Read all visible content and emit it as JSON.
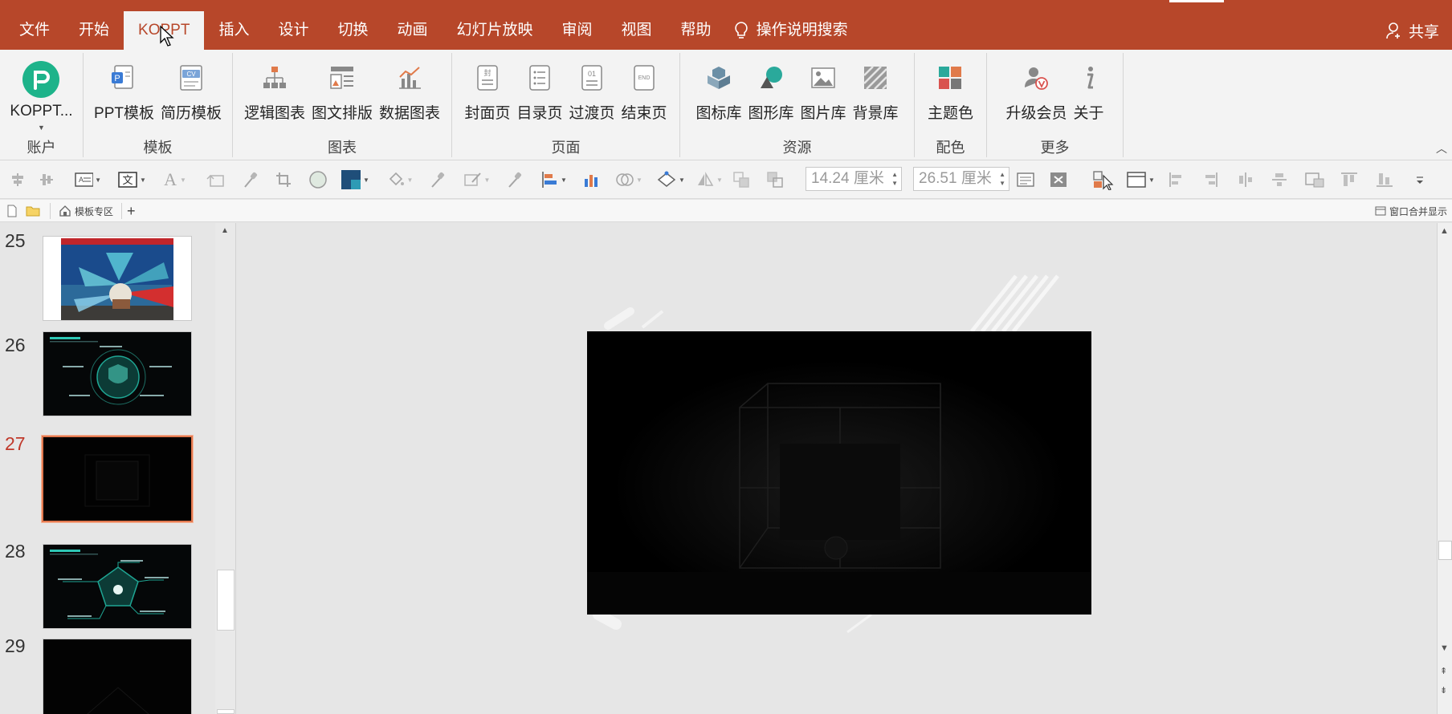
{
  "tabbar": {
    "tabs": [
      "文件",
      "开始",
      "KOPPT",
      "插入",
      "设计",
      "切换",
      "动画",
      "幻灯片放映",
      "审阅",
      "视图",
      "帮助"
    ],
    "active_tab": "KOPPT",
    "tell_me": "操作说明搜索",
    "share": "共享"
  },
  "ribbon": {
    "groups": [
      {
        "name": "账户",
        "buttons": [
          "KOPPT..."
        ]
      },
      {
        "name": "模板",
        "buttons": [
          "PPT模板",
          "简历模板"
        ]
      },
      {
        "name": "图表",
        "buttons": [
          "逻辑图表",
          "图文排版",
          "数据图表"
        ]
      },
      {
        "name": "页面",
        "buttons": [
          "封面页",
          "目录页",
          "过渡页",
          "结束页"
        ]
      },
      {
        "name": "资源",
        "buttons": [
          "图标库",
          "图形库",
          "图片库",
          "背景库"
        ]
      },
      {
        "name": "配色",
        "buttons": [
          "主题色"
        ]
      },
      {
        "name": "更多",
        "buttons": [
          "升级会员",
          "关于"
        ]
      }
    ],
    "icon_text": {
      "cover": "封",
      "transition": "01",
      "end": "END",
      "resume": "CV",
      "ppt": "P"
    }
  },
  "format_toolbar": {
    "height_value": "14.24 厘米",
    "width_value": "26.51 厘米"
  },
  "file_strip": {
    "home_tab": "模板专区",
    "add": "+",
    "merge_window": "窗口合并显示"
  },
  "thumbnails": [
    {
      "number": "25",
      "selected": false
    },
    {
      "number": "26",
      "selected": false
    },
    {
      "number": "27",
      "selected": true
    },
    {
      "number": "28",
      "selected": false
    },
    {
      "number": "29",
      "selected": false
    }
  ],
  "colors": {
    "accent": "#b7472a",
    "selection": "#e3784e",
    "ribbon_bg": "#f3f3f3",
    "workspace_bg": "#e6e6e6"
  }
}
